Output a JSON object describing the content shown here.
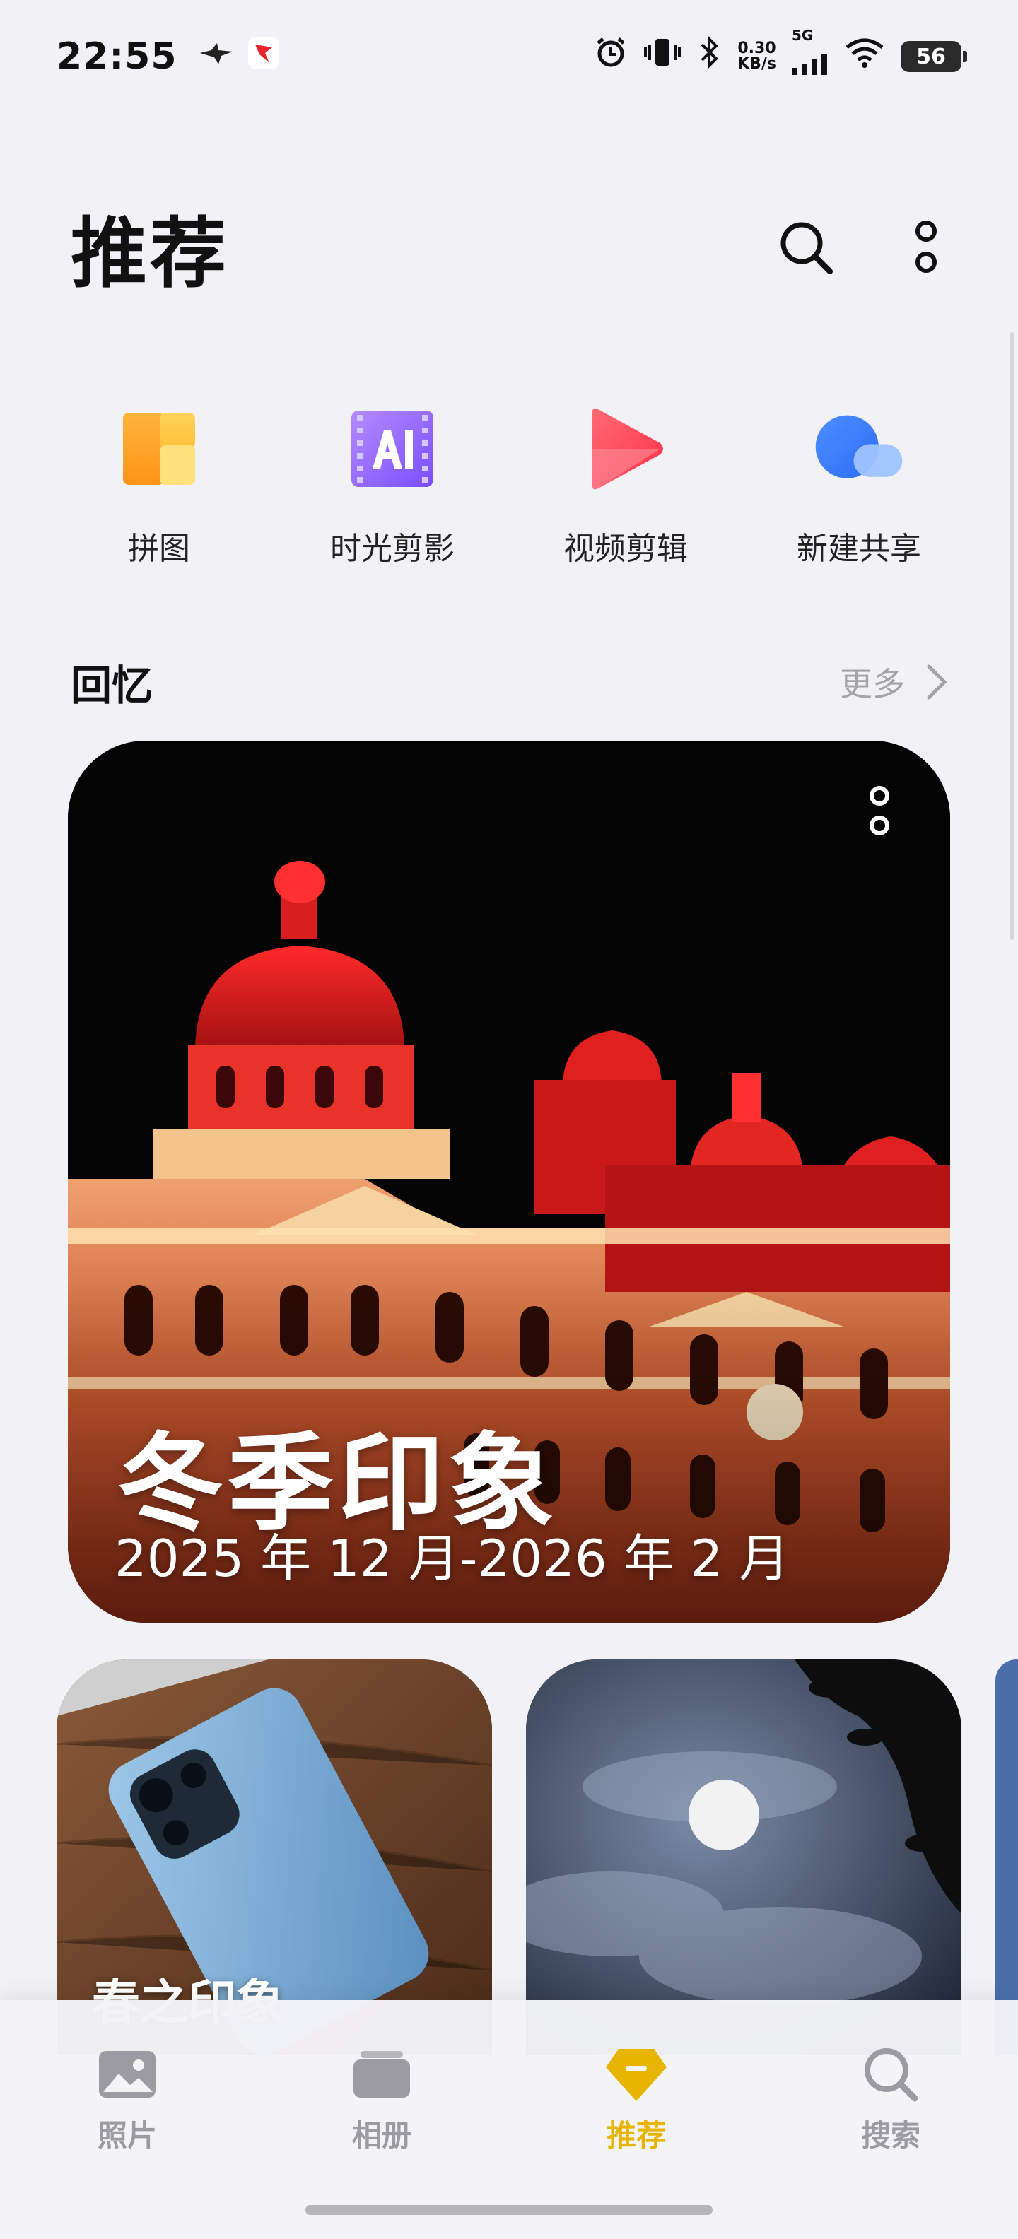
{
  "status_bar": {
    "time": "22:55",
    "speed_value": "0.30",
    "speed_unit": "KB/s",
    "network": "5G",
    "battery": "56"
  },
  "header": {
    "title": "推荐"
  },
  "tools": [
    {
      "label": "拼图",
      "icon": "collage-icon"
    },
    {
      "label": "时光剪影",
      "icon": "ai-film-icon"
    },
    {
      "label": "视频剪辑",
      "icon": "video-edit-icon"
    },
    {
      "label": "新建共享",
      "icon": "shared-album-icon"
    }
  ],
  "memories": {
    "section_title": "回忆",
    "more_label": "更多",
    "featured": {
      "title": "冬季印象",
      "date_range": "2025 年 12 月-2026 年 2 月"
    },
    "cards": [
      {
        "title": "春之印象"
      },
      {
        "title": ""
      }
    ]
  },
  "bottom_nav": {
    "items": [
      {
        "label": "照片",
        "active": false
      },
      {
        "label": "相册",
        "active": false
      },
      {
        "label": "推荐",
        "active": true
      },
      {
        "label": "搜索",
        "active": false
      }
    ]
  },
  "colors": {
    "accent": "#e7b500",
    "background": "#f2f2f6",
    "inactive": "#9b9ba1"
  }
}
